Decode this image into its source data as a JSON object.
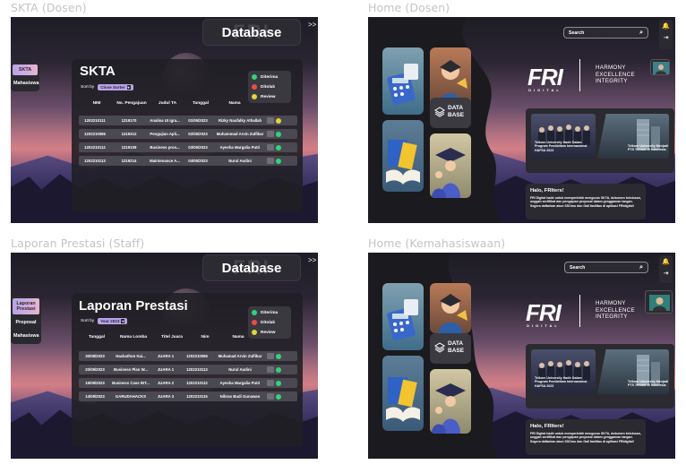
{
  "labels": {
    "skta": "SKTA (Dosen)",
    "home_dosen": "Home (Dosen)",
    "laporan": "Laporan Prestasi (Staff)",
    "home_kema": "Home (Kemahasiswaan)"
  },
  "skta": {
    "header": "Database",
    "watermark": "FRI",
    "chevron": ">>",
    "sidebar": [
      "SKTA",
      "Mahasiswa"
    ],
    "title": "SKTA",
    "sort_label": "Sort by",
    "sort_value": "Close Sorter",
    "legend": [
      {
        "label": "Diterima",
        "color": "#33d27a"
      },
      {
        "label": "Ditolak",
        "color": "#ef4a4a"
      },
      {
        "label": "Review",
        "color": "#e6d23a"
      }
    ],
    "columns": [
      "NIM",
      "No. Pengajuan",
      "Judul TA",
      "Tanggal",
      "Nama"
    ],
    "rows": [
      {
        "nim": "1202210111",
        "no": "1219170",
        "judul": "Analisa UI igra...",
        "tgl": "01/05/2023",
        "nama": "Rizky Naufalky Athallah",
        "status": "#e6d23a"
      },
      {
        "nim": "1202210065",
        "no": "1219312",
        "judul": "Pengujian Apli...",
        "tgl": "02/05/2023",
        "nama": "Muhammad Arvin Zulfikar",
        "status": "#33d27a"
      },
      {
        "nim": "1202210112",
        "no": "1219109",
        "judul": "Business pros...",
        "tgl": "03/05/2023",
        "nama": "Ayesha Margalia Putri",
        "status": "#33d27a"
      },
      {
        "nim": "1202210113",
        "no": "1219214",
        "judul": "Maintenance A...",
        "tgl": "04/05/2023",
        "nama": "Nurul Audini",
        "status": "#33d27a"
      }
    ]
  },
  "laporan": {
    "header": "Database",
    "watermark": "FRI",
    "chevron": ">>",
    "sidebar": [
      "Laporan Prestasi",
      "Proposal",
      "Mahasiswa"
    ],
    "title": "Laporan Prestasi",
    "sort_label": "Sort by",
    "sort_value": "Year 2023",
    "legend": [
      {
        "label": "Diterima",
        "color": "#33d27a"
      },
      {
        "label": "Ditolak",
        "color": "#ef4a4a"
      },
      {
        "label": "Review",
        "color": "#e6d23a"
      }
    ],
    "columns": [
      "Tanggal",
      "Nama Lomba",
      "Titel Juara",
      "Nim",
      "Nama"
    ],
    "rows": [
      {
        "tgl": "30/08/2023",
        "lomba": "Hackathon Kai...",
        "juara": "JUARA 1",
        "nim": "1202210065",
        "nama": "Muhamad Arvin Zulfikar"
      },
      {
        "tgl": "20/09/2023",
        "lomba": "Business Plan W...",
        "juara": "JUARA 1",
        "nim": "1202210113",
        "nama": "Nurul Audini"
      },
      {
        "tgl": "15/09/2023",
        "lomba": "Business Case INT...",
        "juara": "JUARA 2",
        "nim": "1202210112",
        "nama": "Ayesha Margalia Putri"
      },
      {
        "tgl": "14/09/2023",
        "lomba": "GARUDAHACKS",
        "juara": "JUARA 3",
        "nim": "1202210115",
        "nama": "Nibras Budi Gunawan"
      }
    ]
  },
  "home": {
    "search": "Search",
    "logo": "FRI",
    "logo_sub": "DIGITAL",
    "tagline": [
      "HARMONY",
      "EXCELLENCE",
      "INTEGRITY"
    ],
    "database": [
      "DATA",
      "BASE"
    ],
    "news1": "Telkom University Hadir Dalam Program Pendidikan Internasional HAFSA 2023",
    "news2": "Telkom University Menjadi PTS Terbaik di Indonesia",
    "hello_title": "Halo, FRIters!",
    "hello_body": "FRI Digital hadir untuk memperlebih mengurus SKTA, dokumen kelulusan, unggah sertifikat dan pengajuan proposal dalam genggaman tangan. Segera daftarkan akun SSOmu dan Gali fasilitas di aplikasi FRIdigital!"
  }
}
